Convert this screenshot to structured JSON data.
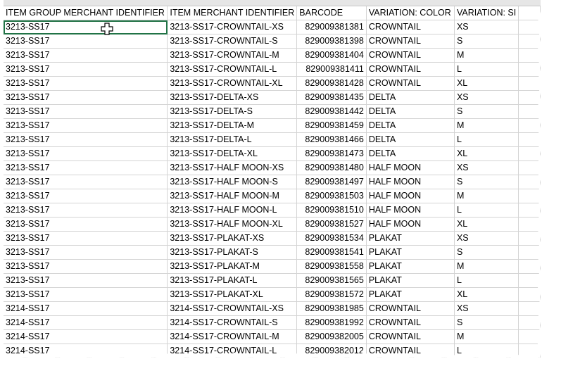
{
  "headers": {
    "group": "ITEM GROUP MERCHANT IDENTIFIER",
    "item": "ITEM MERCHANT IDENTIFIER",
    "barcode": "BARCODE",
    "color": "VARIATION: COLOR",
    "size": "VARIATION: SI"
  },
  "rows": [
    [
      "3213-SS17",
      "3213-SS17-CROWNTAIL-XS",
      "829009381381",
      "CROWNTAIL",
      "XS"
    ],
    [
      "3213-SS17",
      "3213-SS17-CROWNTAIL-S",
      "829009381398",
      "CROWNTAIL",
      "S"
    ],
    [
      "3213-SS17",
      "3213-SS17-CROWNTAIL-M",
      "829009381404",
      "CROWNTAIL",
      "M"
    ],
    [
      "3213-SS17",
      "3213-SS17-CROWNTAIL-L",
      "829009381411",
      "CROWNTAIL",
      "L"
    ],
    [
      "3213-SS17",
      "3213-SS17-CROWNTAIL-XL",
      "829009381428",
      "CROWNTAIL",
      "XL"
    ],
    [
      "3213-SS17",
      "3213-SS17-DELTA-XS",
      "829009381435",
      "DELTA",
      "XS"
    ],
    [
      "3213-SS17",
      "3213-SS17-DELTA-S",
      "829009381442",
      "DELTA",
      "S"
    ],
    [
      "3213-SS17",
      "3213-SS17-DELTA-M",
      "829009381459",
      "DELTA",
      "M"
    ],
    [
      "3213-SS17",
      "3213-SS17-DELTA-L",
      "829009381466",
      "DELTA",
      "L"
    ],
    [
      "3213-SS17",
      "3213-SS17-DELTA-XL",
      "829009381473",
      "DELTA",
      "XL"
    ],
    [
      "3213-SS17",
      "3213-SS17-HALF MOON-XS",
      "829009381480",
      "HALF MOON",
      "XS"
    ],
    [
      "3213-SS17",
      "3213-SS17-HALF MOON-S",
      "829009381497",
      "HALF MOON",
      "S"
    ],
    [
      "3213-SS17",
      "3213-SS17-HALF MOON-M",
      "829009381503",
      "HALF MOON",
      "M"
    ],
    [
      "3213-SS17",
      "3213-SS17-HALF MOON-L",
      "829009381510",
      "HALF MOON",
      "L"
    ],
    [
      "3213-SS17",
      "3213-SS17-HALF MOON-XL",
      "829009381527",
      "HALF MOON",
      "XL"
    ],
    [
      "3213-SS17",
      "3213-SS17-PLAKAT-XS",
      "829009381534",
      "PLAKAT",
      "XS"
    ],
    [
      "3213-SS17",
      "3213-SS17-PLAKAT-S",
      "829009381541",
      "PLAKAT",
      "S"
    ],
    [
      "3213-SS17",
      "3213-SS17-PLAKAT-M",
      "829009381558",
      "PLAKAT",
      "M"
    ],
    [
      "3213-SS17",
      "3213-SS17-PLAKAT-L",
      "829009381565",
      "PLAKAT",
      "L"
    ],
    [
      "3213-SS17",
      "3213-SS17-PLAKAT-XL",
      "829009381572",
      "PLAKAT",
      "XL"
    ],
    [
      "3214-SS17",
      "3214-SS17-CROWNTAIL-XS",
      "829009381985",
      "CROWNTAIL",
      "XS"
    ],
    [
      "3214-SS17",
      "3214-SS17-CROWNTAIL-S",
      "829009381992",
      "CROWNTAIL",
      "S"
    ],
    [
      "3214-SS17",
      "3214-SS17-CROWNTAIL-M",
      "829009382005",
      "CROWNTAIL",
      "M"
    ],
    [
      "3214-SS17",
      "3214-SS17-CROWNTAIL-L",
      "829009382012",
      "CROWNTAIL",
      "L"
    ]
  ],
  "selected_cell": "3213-SS17",
  "cursor_icon": "cell-select-cross-icon",
  "colors": {
    "gridline": "#d4d4d4",
    "selection": "#217346"
  }
}
